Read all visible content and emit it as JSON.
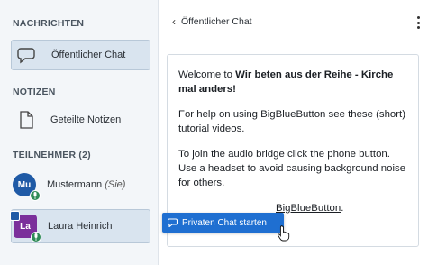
{
  "sidebar": {
    "messages_title": "NACHRICHTEN",
    "public_chat_label": "Öffentlicher Chat",
    "notes_title": "NOTIZEN",
    "shared_notes_label": "Geteilte Notizen",
    "participants_title": "TEILNEHMER (2)",
    "users": [
      {
        "initials": "Mu",
        "name": "Mustermann",
        "you_tag": "(Sie)"
      },
      {
        "initials": "La",
        "name": "Laura Heinrich"
      }
    ]
  },
  "chat": {
    "back_label": "Öffentlicher Chat",
    "welcome_line1_pre": "Welcome to ",
    "welcome_line1_bold": "Wir beten aus der Reihe - Kirche mal anders",
    "welcome_line1_post": "!",
    "help_pre": "For help on using BigBlueButton see these (short) ",
    "help_link": "tutorial videos",
    "help_post": ".",
    "audio_text": "To join the audio bridge click the phone button. Use a headset to avoid causing background noise for others.",
    "learn_link": "BigBlueButton",
    "learn_post": "."
  },
  "tooltip": {
    "label": "Privaten Chat starten"
  },
  "colors": {
    "accent": "#1f6fd1",
    "avatar_mu": "#1f5aa6",
    "avatar_la": "#7b2f9b",
    "mic": "#2e8b57"
  }
}
